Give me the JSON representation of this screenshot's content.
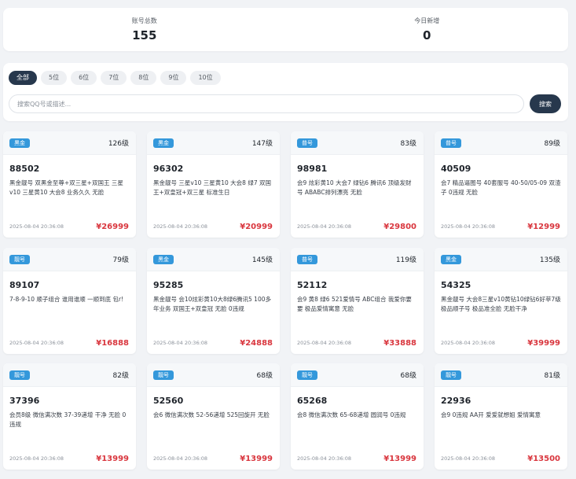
{
  "stats": {
    "total_label": "账号总数",
    "total_value": "155",
    "today_label": "今日新增",
    "today_value": "0"
  },
  "filter": {
    "tabs": [
      "全部",
      "5位",
      "6位",
      "7位",
      "8位",
      "9位",
      "10位"
    ],
    "active_tab": "全部",
    "search_placeholder": "搜索QQ号或描述...",
    "search_button": "搜索"
  },
  "colors": {
    "accent": "#27384d",
    "badge": "#3498db",
    "price": "#d9363e"
  },
  "cards": [
    {
      "badge": "黑金",
      "level": "126级",
      "number": "88502",
      "desc": "黑金靓号 双黑金至尊+双三星+双国王 三星v10 三星黄10 大会8 业务久久 无脸",
      "time": "2025-08-04 20:36:08",
      "price": "¥26999"
    },
    {
      "badge": "黑金",
      "level": "147级",
      "number": "96302",
      "desc": "黑金靓号 三星v10 三星黄10 大会8 绿7 双国王+双皇冠+双三星 标准生日",
      "time": "2025-08-04 20:36:08",
      "price": "¥20999"
    },
    {
      "badge": "普号",
      "level": "83级",
      "number": "98981",
      "desc": "会9 炫彩黄10 大会7 绿钻6 腾讯6 顶级发财号 ABABC排列漂亮 无脸",
      "time": "2025-08-04 20:36:08",
      "price": "¥29800"
    },
    {
      "badge": "普号",
      "level": "89级",
      "number": "40509",
      "desc": "会7 精品逼图号 40套服号 40-50/05-09 双渣子 0违规 无脸",
      "time": "2025-08-04 20:36:08",
      "price": "¥12999"
    },
    {
      "badge": "靓号",
      "level": "79级",
      "number": "89107",
      "desc": "7-8-9-10 顺子组合 谁用谁顺 一顺到底 包r!",
      "time": "2025-08-04 20:36:08",
      "price": "¥16888"
    },
    {
      "badge": "黑金",
      "level": "145级",
      "number": "95285",
      "desc": "黑金靓号 会10炫彩黄10大8绿6腾讯5 100多年业务 双国王+双皇冠 无脸 0违规",
      "time": "2025-08-04 20:36:08",
      "price": "¥24888"
    },
    {
      "badge": "普号",
      "level": "119级",
      "number": "52112",
      "desc": "会9 黄8 绿6 521爱情号 ABC组合 我爱你要要 极品爱情寓意 无脸",
      "time": "2025-08-04 20:36:08",
      "price": "¥33888"
    },
    {
      "badge": "黑金",
      "level": "135级",
      "number": "54325",
      "desc": "黑金靓号 大会8三星v10黄钻10绿钻6好苹7级 极品顺子号 极品准全脸 无脸干净",
      "time": "2025-08-04 20:36:08",
      "price": "¥39999"
    },
    {
      "badge": "靓号",
      "level": "82级",
      "number": "37396",
      "desc": "会员8级 微信满次数 37-39递增 干净 无脸 0违规",
      "time": "2025-08-04 20:36:08",
      "price": "¥13999"
    },
    {
      "badge": "靓号",
      "level": "68级",
      "number": "52560",
      "desc": "会6 微信满次数 52-56递增 525回旋开 无脸",
      "time": "2025-08-04 20:36:08",
      "price": "¥13999"
    },
    {
      "badge": "靓号",
      "level": "68级",
      "number": "65268",
      "desc": "会8 微信满次数 65-68递增 圆润号 0违规",
      "time": "2025-08-04 20:36:08",
      "price": "¥13999"
    },
    {
      "badge": "靓号",
      "level": "81级",
      "number": "22936",
      "desc": "会9 0违规 AA开 爱爱就想姐 爱情寓意",
      "time": "2025-08-04 20:36:08",
      "price": "¥13500"
    }
  ]
}
